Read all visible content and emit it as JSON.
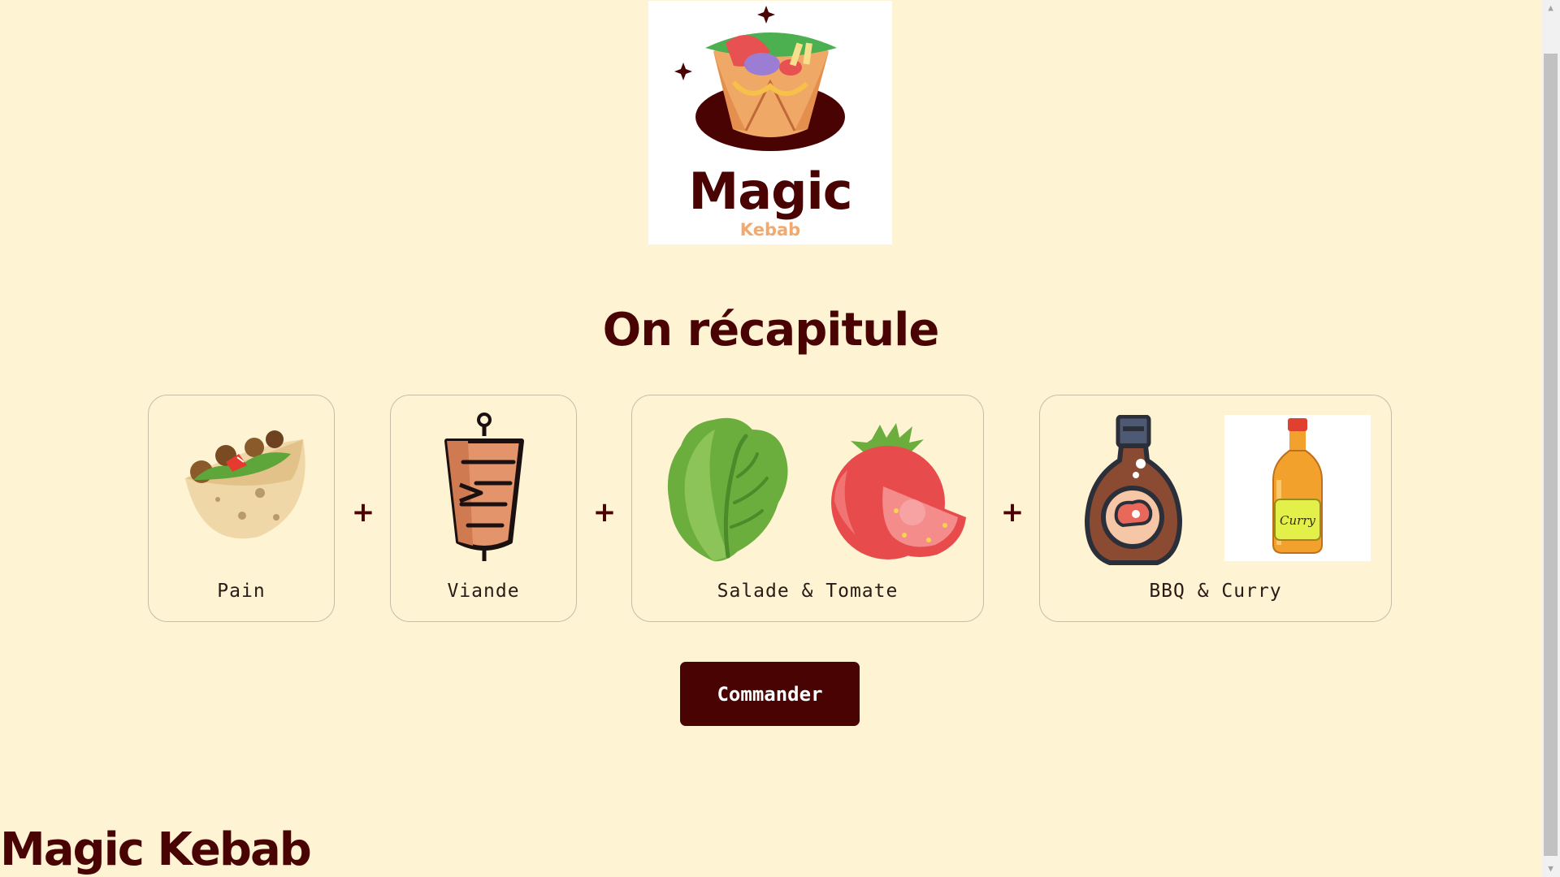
{
  "logo": {
    "main": "Magic",
    "sub": "Kebab"
  },
  "title": "On récapitule",
  "cards": [
    {
      "label": "Pain"
    },
    {
      "label": "Viande"
    },
    {
      "label": "Salade & Tomate"
    },
    {
      "label": "BBQ & Curry"
    }
  ],
  "plus_sign": "+",
  "curry_label": "Curry",
  "order_button": "Commander",
  "footer_title": "Magic Kebab",
  "colors": {
    "background": "#fef3d3",
    "brand": "#4a0303",
    "accent": "#f2a96f"
  },
  "icons": {
    "logo": "kebab-wrap-icon",
    "pain": "pita-bread-icon",
    "viande": "doner-meat-icon",
    "salade": "lettuce-icon",
    "tomate": "tomato-icon",
    "bbq": "bbq-sauce-bottle-icon",
    "curry": "curry-sauce-bottle-icon"
  }
}
